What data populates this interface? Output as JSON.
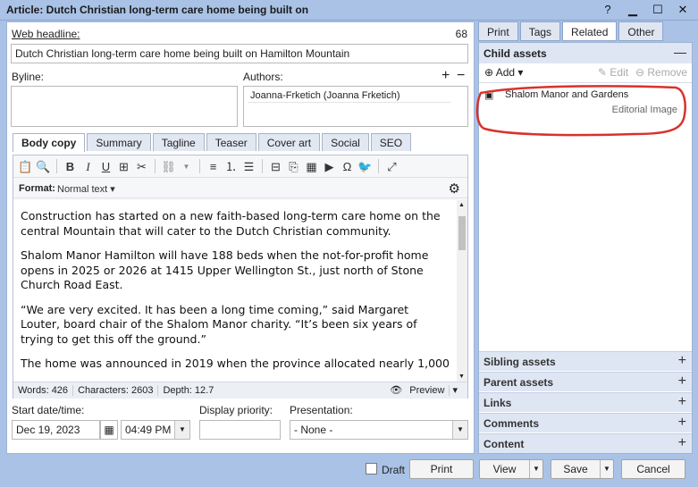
{
  "window": {
    "title": "Article: Dutch Christian long-term care home being built on"
  },
  "form": {
    "web_headline_label": "Web headline:",
    "web_headline_count": "68",
    "web_headline_value": "Dutch Christian long-term care home being built on Hamilton Mountain",
    "byline_label": "Byline:",
    "authors_label": "Authors:",
    "author_value": "Joanna-Frketich (Joanna Frketich)",
    "start_label": "Start date/time:",
    "date_value": "Dec 19, 2023",
    "time_value": "04:49 PM",
    "priority_label": "Display priority:",
    "presentation_label": "Presentation:",
    "presentation_value": "- None -"
  },
  "editor_tabs": [
    "Body copy",
    "Summary",
    "Tagline",
    "Teaser",
    "Cover art",
    "Social",
    "SEO"
  ],
  "editor": {
    "format_label": "Format:",
    "format_value": "Normal text",
    "paragraphs": [
      "Construction has started on a new faith-based long-term care home on the central Mountain that will cater to the Dutch Christian community.",
      "Shalom Manor Hamilton will have 188 beds when the not-for-profit home opens in 2025 or 2026 at 1415 Upper Wellington St., just north of Stone Church Road East.",
      "“We are very excited. It has been a long time coming,” said Margaret Louter, board chair of the Shalom Manor charity. “It’s been six years of trying to get this off the ground.”",
      "The home was announced in 2019 when the province allocated nearly 1,000"
    ],
    "words": "Words: 426",
    "characters": "Characters: 2603",
    "depth": "Depth: 12.7",
    "preview": "Preview"
  },
  "right_tabs": [
    "Print",
    "Tags",
    "Related",
    "Other"
  ],
  "related": {
    "child_assets_label": "Child assets",
    "add_label": "Add",
    "edit_label": "Edit",
    "remove_label": "Remove",
    "child_item_title": "Shalom Manor and Gardens",
    "child_item_type": "Editorial Image",
    "sections": [
      "Sibling assets",
      "Parent assets",
      "Links",
      "Comments",
      "Content"
    ]
  },
  "footer": {
    "draft_label": "Draft",
    "print_label": "Print",
    "view_label": "View",
    "save_label": "Save",
    "cancel_label": "Cancel"
  },
  "colors": {
    "frame": "#a9c2e6",
    "annotation": "#d8322b"
  }
}
